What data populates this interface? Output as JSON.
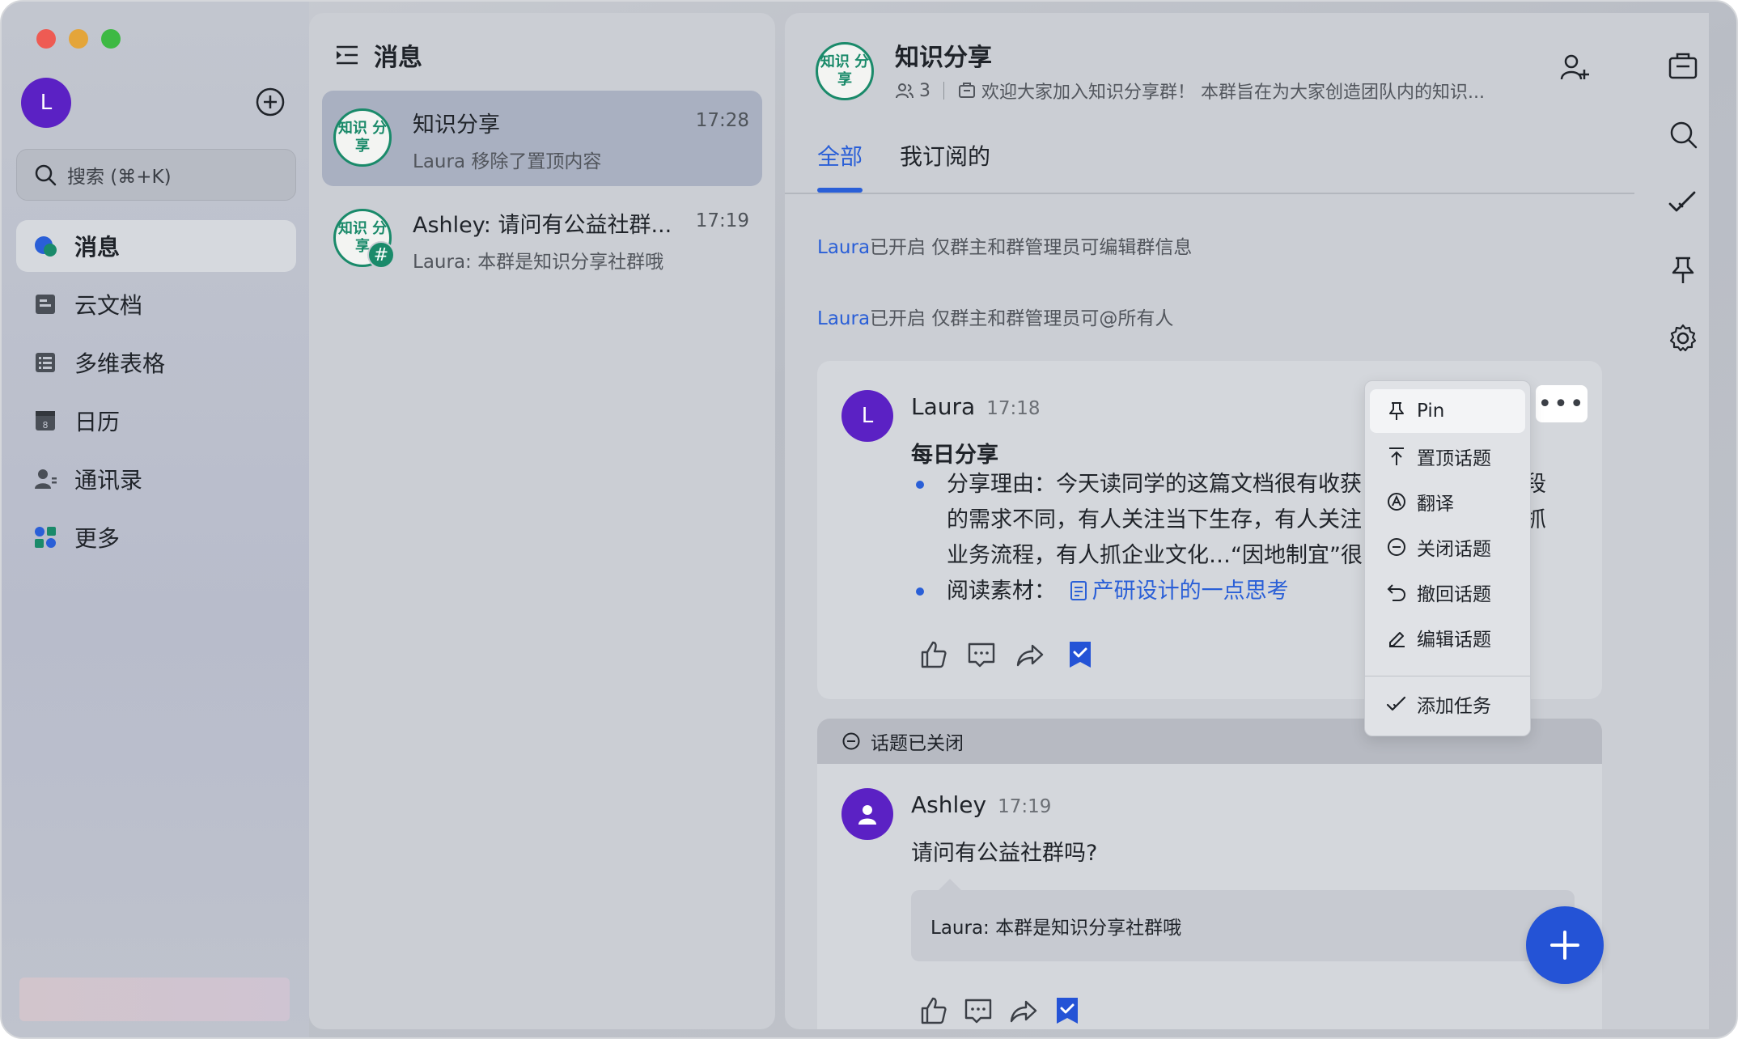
{
  "sidebar": {
    "avatar_letter": "L",
    "search_placeholder": "搜索 (⌘+K)",
    "items": [
      {
        "label": "消息",
        "icon": "message-icon"
      },
      {
        "label": "云文档",
        "icon": "docs-icon"
      },
      {
        "label": "多维表格",
        "icon": "base-icon"
      },
      {
        "label": "日历",
        "icon": "calendar-icon"
      },
      {
        "label": "通讯录",
        "icon": "contacts-icon"
      },
      {
        "label": "更多",
        "icon": "more-apps-icon"
      }
    ]
  },
  "message_list": {
    "title": "消息",
    "chats": [
      {
        "avatar_text": "知识 分享",
        "title": "知识分享",
        "time": "17:28",
        "subtitle": "Laura 移除了置顶内容"
      },
      {
        "avatar_text": "知识 分享",
        "badge": "#",
        "title": "Ashley: 请问有公益社群...",
        "time": "17:19",
        "subtitle": "Laura: 本群是知识分享社群哦"
      }
    ]
  },
  "chat": {
    "avatar_text": "知识 分享",
    "title": "知识分享",
    "member_count": "3",
    "announcement": "欢迎大家加入知识分享群！ 本群旨在为大家创造团队内的知识...",
    "tabs": [
      "全部",
      "我订阅的"
    ],
    "system_messages": [
      {
        "name": "Laura",
        "text": "已开启 仅群主和群管理员可编辑群信息"
      },
      {
        "name": "Laura",
        "text": "已开启 仅群主和群管理员可@所有人"
      }
    ],
    "post": {
      "avatar_letter": "L",
      "author": "Laura",
      "time": "17:18",
      "title": "每日分享",
      "lines": [
        "分享理由：今天读同学的这篇文档很有收获",
        "的需求不同，有人关注当下生存，有人关注",
        "业务流程，有人抓企业文化…“因地制宜”很",
        "阅读素材："
      ],
      "line_tails": [
        "段",
        "抓"
      ],
      "doc_link": "产研设计的一点思考"
    },
    "closed_label": "话题已关闭",
    "reply_post": {
      "author": "Ashley",
      "time": "17:19",
      "text": "请问有公益社群吗?",
      "reply": "Laura: 本群是知识分享社群哦"
    }
  },
  "context_menu": {
    "more_label": "•••",
    "items": [
      {
        "label": "Pin",
        "icon": "pin-icon"
      },
      {
        "label": "置顶话题",
        "icon": "top-icon"
      },
      {
        "label": "翻译",
        "icon": "translate-icon"
      },
      {
        "label": "关闭话题",
        "icon": "close-topic-icon"
      },
      {
        "label": "撤回话题",
        "icon": "undo-icon"
      },
      {
        "label": "编辑话题",
        "icon": "edit-icon"
      },
      {
        "label": "添加任务",
        "icon": "task-icon"
      }
    ]
  },
  "colors": {
    "accent": "#2a5fd7",
    "group_green": "#1a8a6a",
    "avatar_purple": "#5b21c4"
  }
}
